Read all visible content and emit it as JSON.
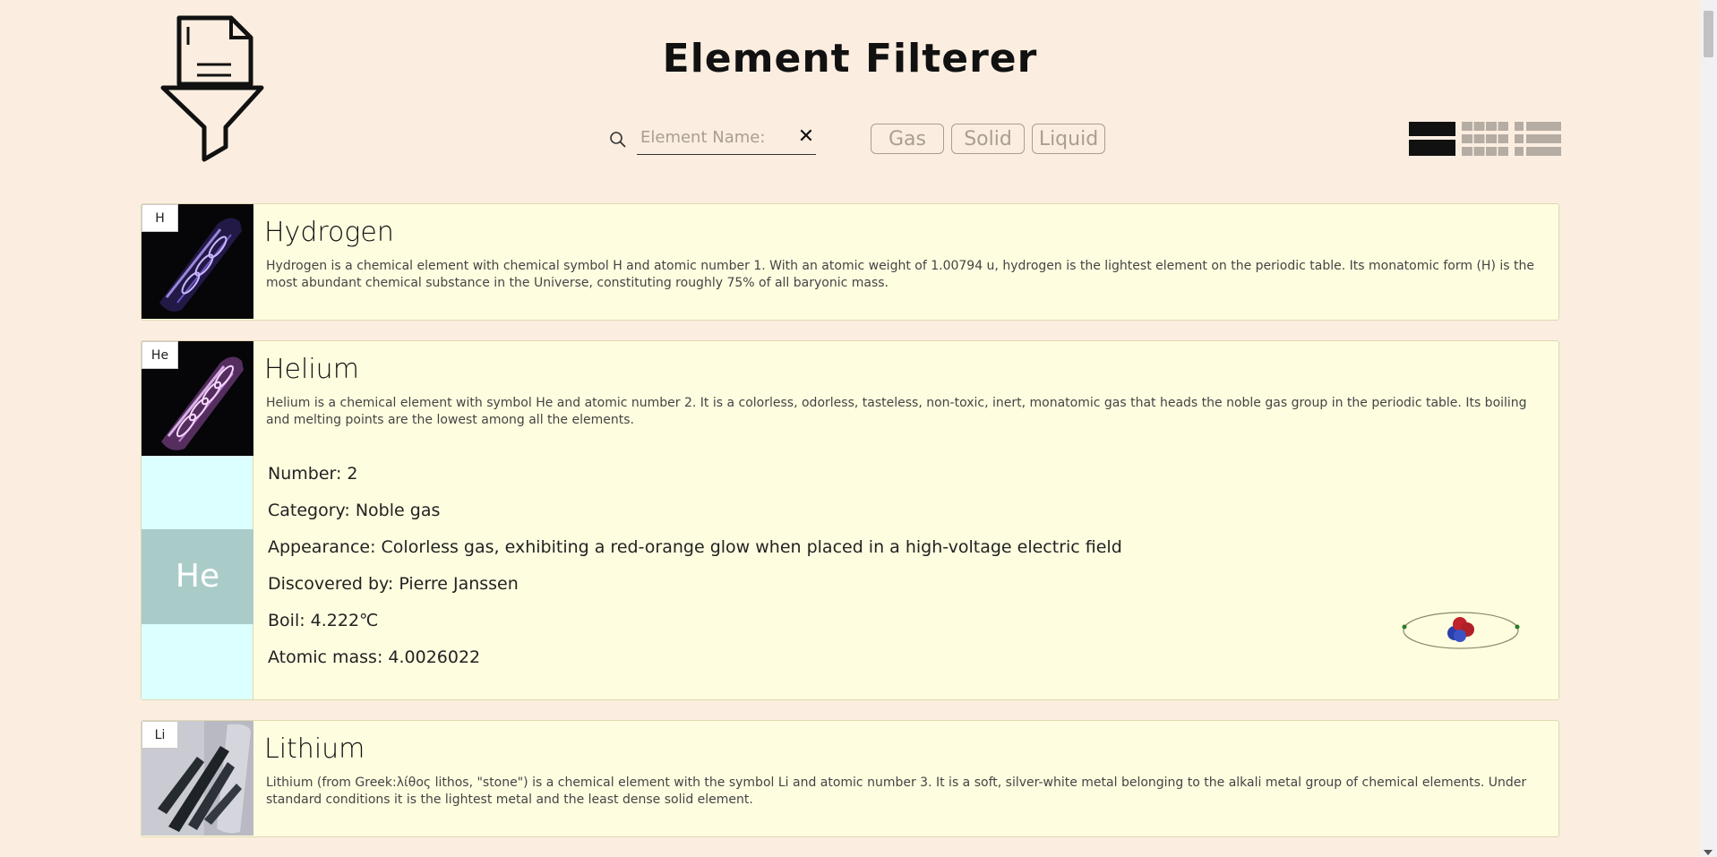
{
  "app": {
    "title": "Element Filterer"
  },
  "search": {
    "placeholder": "Element Name:",
    "value": "",
    "clear_icon": "close-icon"
  },
  "filters": [
    {
      "label": "Gas"
    },
    {
      "label": "Solid"
    },
    {
      "label": "Liquid"
    }
  ],
  "views": [
    {
      "icon": "list-view-icon",
      "active": true
    },
    {
      "icon": "grid-view-icon",
      "active": false
    },
    {
      "icon": "compact-list-view-icon",
      "active": false
    }
  ],
  "elements": [
    {
      "symbol": "H",
      "name": "Hydrogen",
      "description": "Hydrogen is a chemical element with chemical symbol H and atomic number 1. With an atomic weight of 1.00794 u, hydrogen is the lightest element on the periodic table. Its monatomic form (H) is the most abundant chemical substance in the Universe, constituting roughly 75% of all baryonic mass."
    },
    {
      "symbol": "He",
      "name": "Helium",
      "description": "Helium is a chemical element with symbol He and atomic number 2. It is a colorless, odorless, tasteless, non-toxic, inert, monatomic gas that heads the noble gas group in the periodic table. Its boiling and melting points are the lowest among all the elements.",
      "expanded": true,
      "details": {
        "number": "Number: 2",
        "category": "Category: Noble gas",
        "appearance": "Appearance: Colorless gas, exhibiting a red-orange glow when placed in a high-voltage electric field",
        "discovered": "Discovered by: Pierre Janssen",
        "boil": "Boil: 4.222℃",
        "mass": "Atomic mass: 4.0026022"
      }
    },
    {
      "symbol": "Li",
      "name": "Lithium",
      "description": "Lithium (from Greek:λίθος lithos, \"stone\") is a chemical element with the symbol Li and atomic number 3. It is a soft, silver-white metal belonging to the alkali metal group of chemical elements. Under standard conditions it is the lightest metal and the least dense solid element."
    }
  ],
  "colors": {
    "background": "#fbeee0",
    "card": "#fffde0",
    "detail_side": "#dcffff",
    "detail_symbol": "#a9ccc9",
    "filter_border": "#a89e92"
  }
}
